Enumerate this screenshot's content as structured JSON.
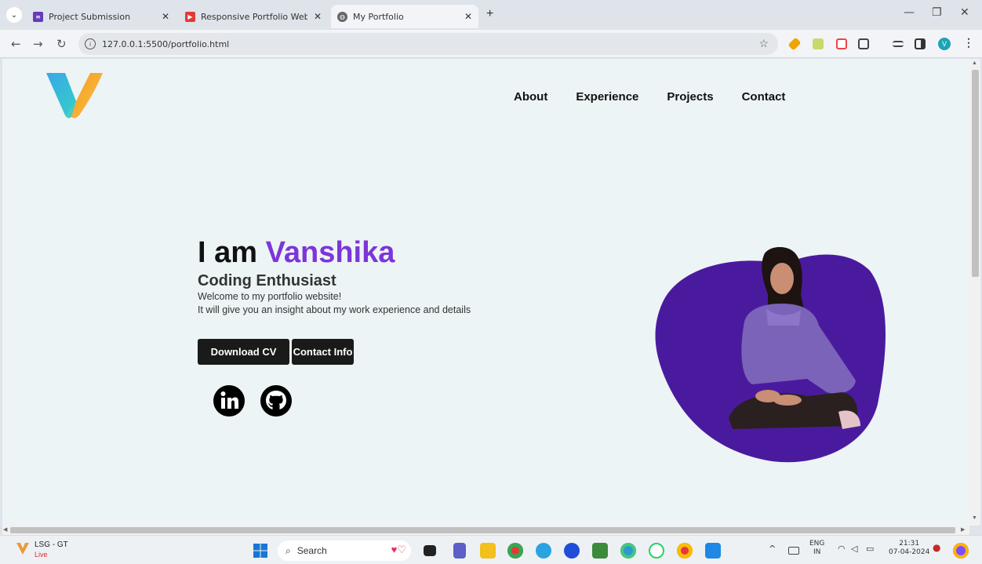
{
  "browser": {
    "tabs": [
      {
        "title": "Project Submission",
        "favicon": "forms-icon",
        "color": "#673ab7",
        "active": false
      },
      {
        "title": "Responsive Portfolio Website F",
        "favicon": "youtube-icon",
        "color": "#e53935",
        "active": false
      },
      {
        "title": "My Portfolio",
        "favicon": "globe-icon",
        "color": "#555555",
        "active": true
      }
    ],
    "new_tab": "+",
    "url": "127.0.0.1:5500/portfolio.html",
    "profile_initial": "V"
  },
  "page": {
    "nav": [
      "About",
      "Experience",
      "Projects",
      "Contact"
    ],
    "hero": {
      "greeting": "I am ",
      "name": "Vanshika",
      "subtitle": "Coding Enthusiast",
      "line1": "Welcome to my portfolio website!",
      "line2": "It will give you an insight about my work experience and details"
    },
    "buttons": {
      "download": "Download CV",
      "contact": "Contact Info"
    },
    "accent_color": "#7d35d9",
    "blob_color": "#4a1a9e"
  },
  "taskbar": {
    "widget_title": "LSG - GT",
    "widget_sub": "Live",
    "search_placeholder": "Search",
    "lang_top": "ENG",
    "lang_bottom": "IN",
    "time": "21:31",
    "date": "07-04-2024"
  }
}
